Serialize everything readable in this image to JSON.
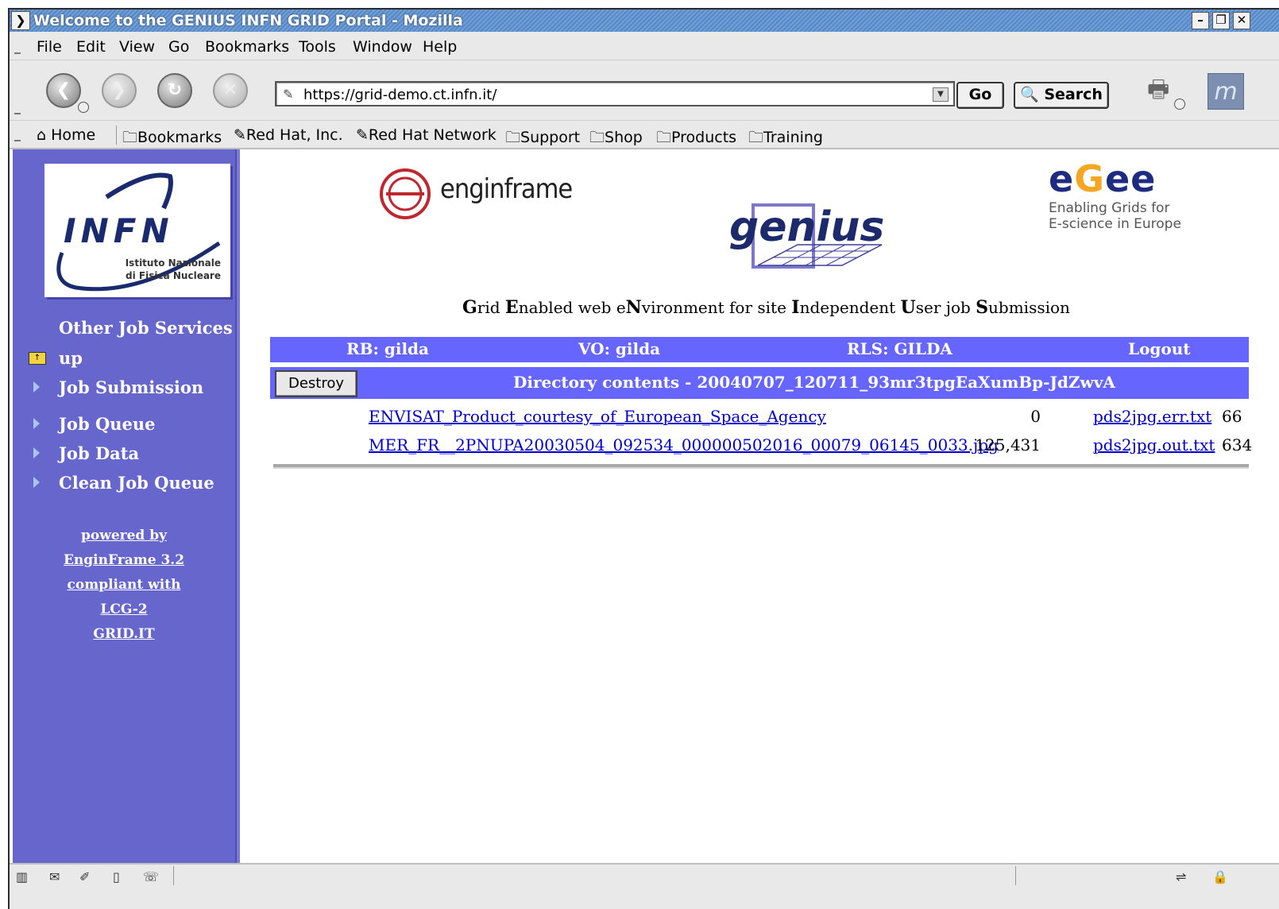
{
  "window": {
    "title": "Welcome to the GENIUS INFN GRID Portal - Mozilla",
    "menu_glyph": "❯",
    "minimize": "–",
    "maximize": "❐",
    "close": "✕"
  },
  "menubar": {
    "items": [
      "File",
      "Edit",
      "View",
      "Go",
      "Bookmarks",
      "Tools",
      "Window",
      "Help"
    ]
  },
  "navbar": {
    "url": "https://grid-demo.ct.infn.it/",
    "go_label": "Go",
    "search_label": "Search",
    "back_glyph": "❮",
    "forward_glyph": "❯",
    "reload_glyph": "↻",
    "stop_glyph": "✕",
    "moz_glyph": "m"
  },
  "personal_toolbar": {
    "home": "Home",
    "items": [
      "Bookmarks",
      "Red Hat, Inc.",
      "Red Hat Network",
      "Support",
      "Shop",
      "Products",
      "Training"
    ]
  },
  "sidebar": {
    "logo_word": "INFN",
    "logo_sub1": "Istituto Nazionale",
    "logo_sub2": "di Fisica Nucleare",
    "section_title": "Other Job Services",
    "up_label": "up",
    "links": [
      "Job Submission",
      "Job Queue",
      "Job Data",
      "Clean Job Queue"
    ],
    "powered": [
      "powered by",
      "EnginFrame 3.2",
      "compliant with",
      "LCG-2",
      "GRID.IT"
    ]
  },
  "header": {
    "enginframe_text": "enginframe",
    "genius_text": "genius",
    "egee_word_pre": "e",
    "egee_word_accent": "G",
    "egee_word_post": "ee",
    "egee_line1": "Enabling Grids for",
    "egee_line2": "E-science in Europe",
    "tagline_parts": [
      [
        "G",
        "rid "
      ],
      [
        "E",
        "nabled web e"
      ],
      [
        "N",
        "vironment for site "
      ],
      [
        "I",
        "ndependent "
      ],
      [
        "U",
        "ser job "
      ],
      [
        "S",
        "ubmission"
      ]
    ]
  },
  "status": {
    "rb": "RB: gilda",
    "vo": "VO: gilda",
    "rls": "RLS: GILDA",
    "logout": "Logout"
  },
  "directory": {
    "destroy_label": "Destroy",
    "title": "Directory contents - 20040707_120711_93mr3tpgEaXumBp-JdZwvA",
    "files": [
      {
        "name": "ENVISAT_Product_courtesy_of_European_Space_Agency",
        "size": "0",
        "out": "pds2jpg.err.txt",
        "out_size": "66"
      },
      {
        "name": "MER_FR__2PNUPA20030504_092534_000000502016_00079_06145_0033.jpg",
        "size": "125,431",
        "out": "pds2jpg.out.txt",
        "out_size": "634"
      }
    ]
  },
  "colors": {
    "sidebar": "#6666cc",
    "header_band": "#6666ff",
    "link": "#0000cc"
  }
}
